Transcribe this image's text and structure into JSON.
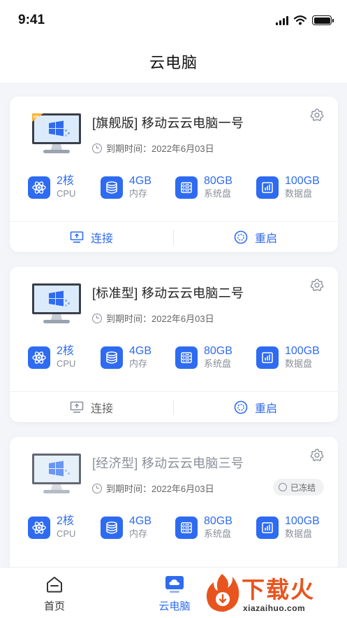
{
  "status_bar": {
    "time": "9:41"
  },
  "nav": {
    "title": "云电脑"
  },
  "cards": [
    {
      "title": "[旗舰版] 移动云云电脑一号",
      "expire": "到期时间：2022年6月03日",
      "vip_badge": true,
      "frozen": false,
      "specs": [
        {
          "value": "2核",
          "label": "CPU",
          "icon": "atom-icon"
        },
        {
          "value": "4GB",
          "label": "内存",
          "icon": "database-icon"
        },
        {
          "value": "80GB",
          "label": "系统盘",
          "icon": "disk-list-icon"
        },
        {
          "value": "100GB",
          "label": "数据盘",
          "icon": "bar-chart-icon"
        }
      ],
      "connect": {
        "label": "连接",
        "enabled": true
      },
      "restart": {
        "label": "重启",
        "enabled": true
      }
    },
    {
      "title": "[标准型] 移动云云电脑二号",
      "expire": "到期时间：2022年6月03日",
      "vip_badge": false,
      "frozen": false,
      "specs": [
        {
          "value": "2核",
          "label": "CPU",
          "icon": "atom-icon"
        },
        {
          "value": "4GB",
          "label": "内存",
          "icon": "database-icon"
        },
        {
          "value": "80GB",
          "label": "系统盘",
          "icon": "disk-list-icon"
        },
        {
          "value": "100GB",
          "label": "数据盘",
          "icon": "bar-chart-icon"
        }
      ],
      "connect": {
        "label": "连接",
        "enabled": false
      },
      "restart": {
        "label": "重启",
        "enabled": true
      }
    },
    {
      "title": "[经济型] 移动云云电脑三号",
      "expire": "到期时间：2022年6月03日",
      "vip_badge": false,
      "frozen": true,
      "status_badge": "已冻结",
      "specs": [
        {
          "value": "2核",
          "label": "CPU",
          "icon": "atom-icon"
        },
        {
          "value": "4GB",
          "label": "内存",
          "icon": "database-icon"
        },
        {
          "value": "80GB",
          "label": "系统盘",
          "icon": "disk-list-icon"
        },
        {
          "value": "100GB",
          "label": "数据盘",
          "icon": "bar-chart-icon"
        }
      ]
    }
  ],
  "tab_bar": {
    "items": [
      {
        "label": "首页",
        "icon": "home-icon",
        "active": false
      },
      {
        "label": "云电脑",
        "icon": "cloud-computer-icon",
        "active": true
      }
    ]
  },
  "watermark": {
    "text": "下载火",
    "url": "xiazaihuo.com"
  },
  "colors": {
    "accent": "#2e6bf0",
    "background": "#f3f5f8",
    "watermark": "#e8541e"
  }
}
